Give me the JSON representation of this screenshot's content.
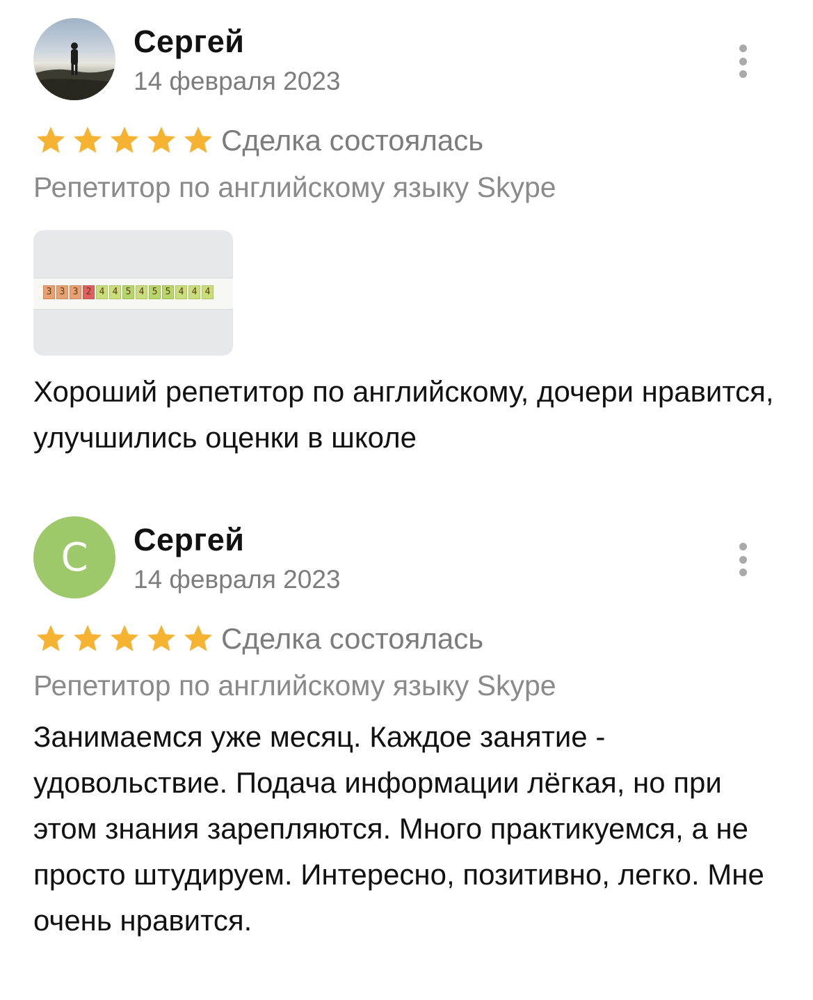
{
  "reviews": [
    {
      "author": "Сергей",
      "date": "14 февраля 2023",
      "avatar": {
        "type": "photo",
        "icon": "user-photo"
      },
      "rating": 5,
      "status": "Сделка состоялась",
      "service": "Репетитор по английскому языку Skype",
      "attachment": {
        "grades": [
          "3",
          "3",
          "3",
          "2",
          "4",
          "4",
          "5",
          "4",
          "5",
          "5",
          "4",
          "4",
          "4"
        ]
      },
      "text": "Хороший репетитор по английскому, дочери нравится, улучшились оценки в школе"
    },
    {
      "author": "Сергей",
      "date": "14 февраля 2023",
      "avatar": {
        "type": "letter",
        "letter": "С",
        "color": "#9dc96b"
      },
      "rating": 5,
      "status": "Сделка состоялась",
      "service": "Репетитор по английскому языку Skype",
      "text": "Занимаемся уже месяц. Каждое занятие - удовольствие. Подача информации лёгкая, но при этом знания зарепляются. Много практикуемся, а не просто штудируем. Интересно, позитивно, легко. Мне очень нравится."
    }
  ],
  "colors": {
    "star": "#f5b331",
    "grade_bad": "#e8a070",
    "grade_two": "#e06060",
    "grade_good": "#c9dd7a",
    "grade_five": "#b7d66a"
  }
}
